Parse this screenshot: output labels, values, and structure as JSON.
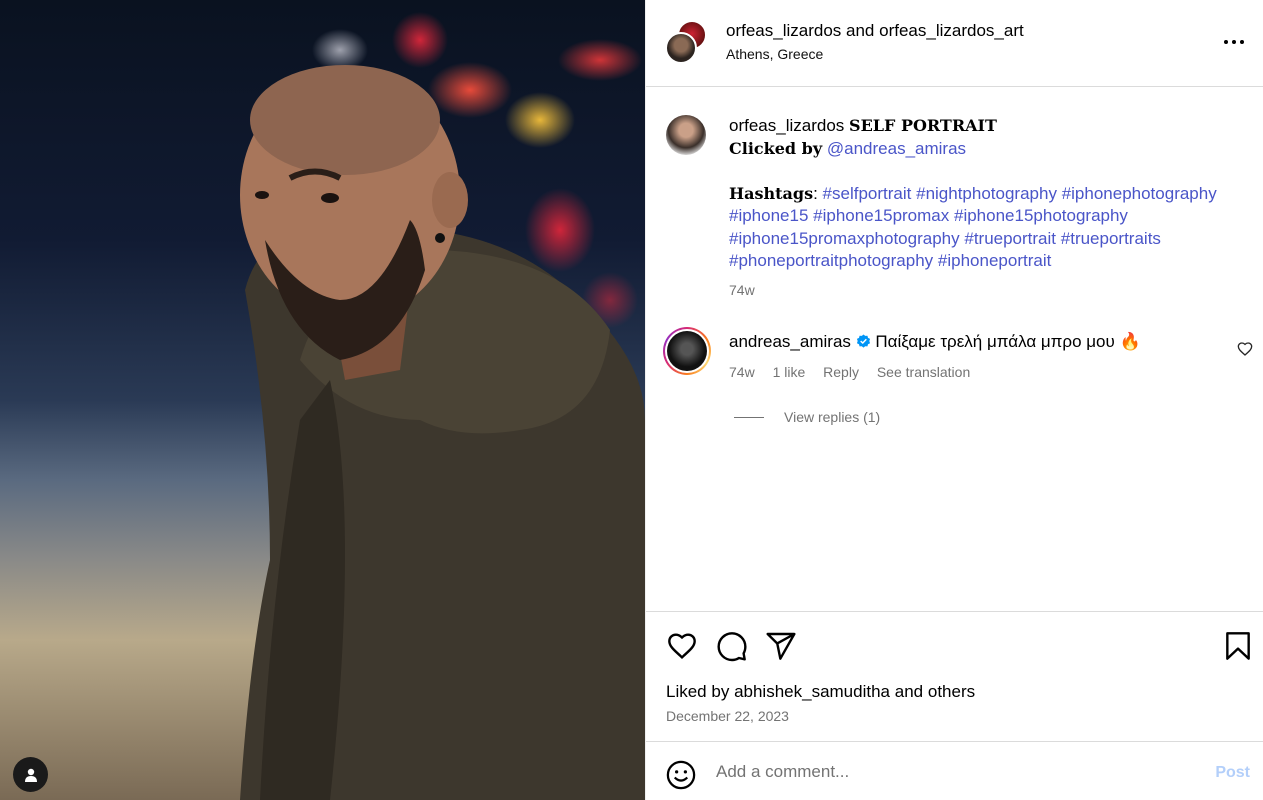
{
  "header": {
    "user1": "orfeas_lizardos",
    "and": "and",
    "user2": "orfeas_lizardos_art",
    "location": "Athens, Greece",
    "more_icon": "more-horizontal-icon"
  },
  "caption": {
    "username": "orfeas_lizardos",
    "title": "SELF PORTRAIT",
    "clicked_label": "Clicked by",
    "clicked_user": "@andreas_amiras",
    "hashtags_label": "Hashtags",
    "hashtags_colon": ":",
    "tags": [
      "#selfportrait",
      "#nightphotography",
      "#iphonephotography",
      "#iphone15",
      "#iphone15promax",
      "#iphone15photography",
      "#iphone15promaxphotography",
      "#trueportrait",
      "#trueportraits",
      "#phoneportraitphotography",
      "#iphoneportrait"
    ],
    "age": "74w"
  },
  "comment": {
    "username": "andreas_amiras",
    "text": "Παίξαμε τρελή μπάλα μπρο μου",
    "emoji": "🔥",
    "age": "74w",
    "likes": "1 like",
    "reply": "Reply",
    "see_translation": "See translation",
    "view_replies": "View replies (1)"
  },
  "actions": {
    "liked_by": "Liked by",
    "liked_user": "abhishek_samuditha",
    "and": "and",
    "others": "others",
    "date": "December 22, 2023"
  },
  "add_comment": {
    "placeholder": "Add a comment...",
    "post": "Post"
  },
  "colors": {
    "link": "#4a55c8",
    "muted": "#737373",
    "post_disabled": "#b3cffa",
    "border": "#dbdbdb"
  }
}
